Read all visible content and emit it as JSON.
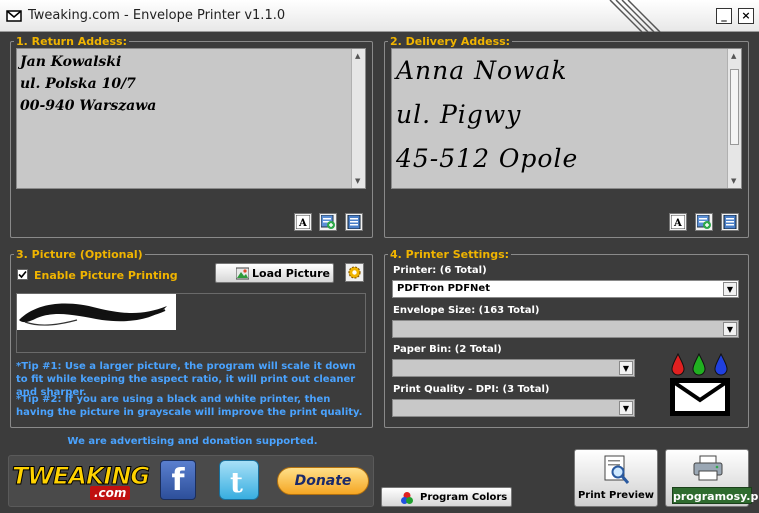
{
  "window": {
    "title": "Tweaking.com - Envelope Printer v1.1.0",
    "minimize_label": "_",
    "close_label": "×"
  },
  "return_address": {
    "legend": "1. Return Addess:",
    "lines": [
      "Jan Kowalski",
      "ul. Polska 10/7",
      "00-940 Warszawa"
    ]
  },
  "delivery_address": {
    "legend": "2. Delivery Addess:",
    "lines": [
      "Anna Nowak",
      "ul. Pigwy",
      "45-512 Opole"
    ]
  },
  "picture": {
    "legend": "3. Picture (Optional)",
    "enable_label": "Enable Picture Printing",
    "enabled": true,
    "load_button": "Load Picture",
    "tip1": "*Tip #1: Use a larger picture, the program will scale it down to fit while keeping the aspect ratio, it will print out cleaner and sharper.",
    "tip2": "*Tip #2: If you are using a black and white printer, then having the picture in grayscale will improve the print quality."
  },
  "printer_settings": {
    "legend": "4. Printer Settings:",
    "printer_label": "Printer: (6 Total)",
    "printer_value": "PDFTron PDFNet",
    "envelope_label": "Envelope Size: (163 Total)",
    "envelope_value": "",
    "bin_label": "Paper Bin: (2 Total)",
    "bin_value": "",
    "dpi_label": "Print Quality - DPI: (3 Total)",
    "dpi_value": ""
  },
  "footer": {
    "advert_text": "We are advertising and donation supported.",
    "logo_text": "TWEAKING",
    "logo_sub": ".com",
    "facebook_glyph": "f",
    "donate_label": "Donate",
    "program_colors_label": "Program Colors",
    "print_preview_label": "Print Preview",
    "watermark_text": "programosy.pl"
  },
  "colors": {
    "accent_label": "#f0b400",
    "tip_blue": "#4aa3ff",
    "background": "#3c3c3c"
  }
}
